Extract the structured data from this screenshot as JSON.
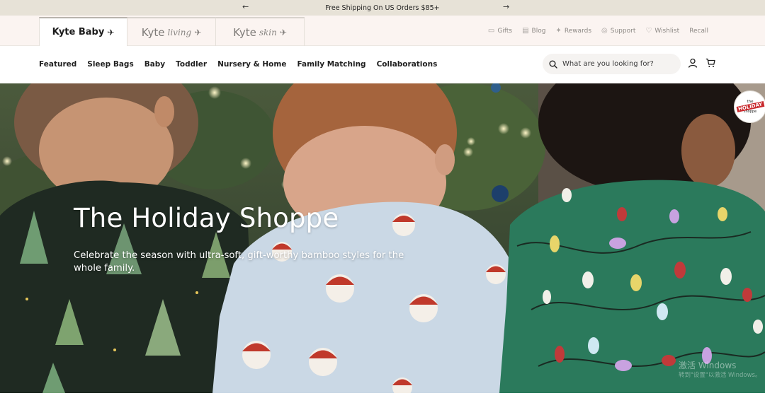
{
  "announcement": {
    "text": "Free Shipping On US Orders $85+",
    "prev_icon": "←",
    "next_icon": "→"
  },
  "brands": [
    {
      "word": "Kyte Baby",
      "script": "",
      "glyph": "✈"
    },
    {
      "word": "Kyte",
      "script": "living",
      "glyph": "✈"
    },
    {
      "word": "Kyte",
      "script": "skin",
      "glyph": "✈"
    }
  ],
  "utility": {
    "gifts": "Gifts",
    "blog": "Blog",
    "rewards": "Rewards",
    "support": "Support",
    "wishlist": "Wishlist",
    "recall": "Recall"
  },
  "nav": {
    "links": [
      "Featured",
      "Sleep Bags",
      "Baby",
      "Toddler",
      "Nursery & Home",
      "Family Matching",
      "Collaborations"
    ],
    "search_placeholder": "What are you looking for?"
  },
  "hero": {
    "title": "The Holiday Shoppe",
    "subtitle": "Celebrate the season with ultra-soft, gift-worthy bamboo styles for the whole family.",
    "badge_top": "the",
    "badge_mid": "HOLIDAY",
    "badge_bottom": "shoppe"
  },
  "watermark": {
    "line1": "激活 Windows",
    "line2": "转到\"设置\"以激活 Windows。"
  },
  "colors": {
    "announcement_bg": "#e7e2d7",
    "brandbar_bg": "#fbf4f1",
    "badge_red": "#c8282c"
  }
}
